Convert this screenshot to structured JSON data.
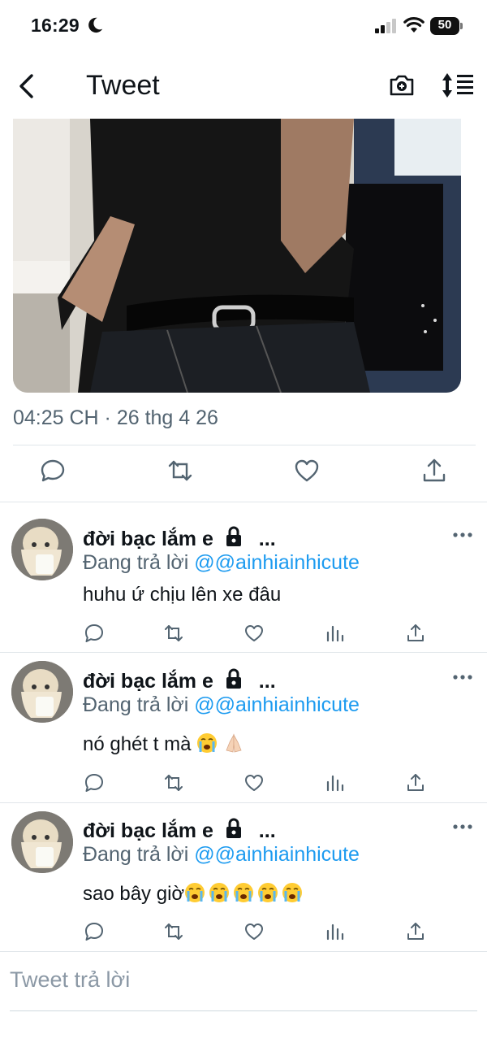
{
  "status_bar": {
    "time": "16:29",
    "battery": "50"
  },
  "nav": {
    "title": "Tweet",
    "back_icon": "chevron-left-icon",
    "camera_icon": "camera-icon",
    "sort_icon": "sort-icon"
  },
  "tweet": {
    "timestamp": "04:25 CH · 26 thg 4 26",
    "actions": [
      "reply-icon",
      "retweet-icon",
      "like-icon",
      "share-icon"
    ]
  },
  "replies": [
    {
      "name": "đời bạc lắm e",
      "ellipsis": "...",
      "replying_prefix": "Đang trả lời ",
      "mention": "@@ainhiainhicute",
      "text": "huhu ứ chịu lên xe đâu",
      "emojis": []
    },
    {
      "name": "đời bạc lắm e",
      "ellipsis": "...",
      "replying_prefix": "Đang trả lời ",
      "mention": "@@ainhiainhicute",
      "text": "nó ghét t mà ",
      "emojis": [
        "loudly-crying-face",
        "folded-hands"
      ]
    },
    {
      "name": "đời bạc lắm e",
      "ellipsis": "...",
      "replying_prefix": "Đang trả lời ",
      "mention": "@@ainhiainhicute",
      "text": "sao bây giờ",
      "emojis": [
        "loudly-crying-face",
        "loudly-crying-face",
        "loudly-crying-face",
        "loudly-crying-face",
        "loudly-crying-face"
      ]
    }
  ],
  "compose": {
    "placeholder": "Tweet trả lời"
  },
  "colors": {
    "accent": "#1d9bf0",
    "secondary_text": "#536471",
    "divider": "#e1e6ea"
  }
}
